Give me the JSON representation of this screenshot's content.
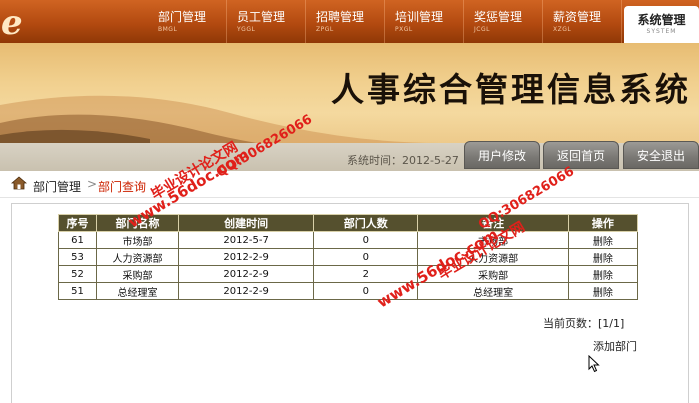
{
  "header": {
    "nav": [
      {
        "label": "部门管理",
        "sub": "BMGL"
      },
      {
        "label": "员工管理",
        "sub": "YGGL"
      },
      {
        "label": "招聘管理",
        "sub": "ZPGL"
      },
      {
        "label": "培训管理",
        "sub": "PXGL"
      },
      {
        "label": "奖惩管理",
        "sub": "JCGL"
      },
      {
        "label": "薪资管理",
        "sub": "XZGL"
      }
    ],
    "active": {
      "label": "系统管理",
      "sub": "SYSTEM"
    }
  },
  "banner": {
    "title": "人事综合管理信息系统",
    "system_time": "系统时间：2012-5-27",
    "buttons": {
      "profile": "用户修改",
      "home": "返回首页",
      "logout": "安全退出"
    }
  },
  "breadcrumb": {
    "parent": "部门管理",
    "sep": ">",
    "current": "部门查询"
  },
  "table": {
    "headers": [
      "序号",
      "部门名称",
      "创建时间",
      "部门人数",
      "备注",
      "操作"
    ],
    "rows": [
      [
        "61",
        "市场部",
        "2012-5-7",
        "0",
        "市场部",
        "删除"
      ],
      [
        "53",
        "人力资源部",
        "2012-2-9",
        "0",
        "人力资源部",
        "删除"
      ],
      [
        "52",
        "采购部",
        "2012-2-9",
        "2",
        "采购部",
        "删除"
      ],
      [
        "51",
        "总经理室",
        "2012-2-9",
        "0",
        "总经理室",
        "删除"
      ]
    ]
  },
  "pager": "当前页数：[1/1]",
  "add_link": "添加部门",
  "watermarks": {
    "site": "www.56doc.com",
    "brand": "毕业设计论文网",
    "qq": "QQ:306826066"
  },
  "colors": {
    "nav_bg": "#b34a10",
    "table_header": "#55502e",
    "crumb_active": "#cc2200",
    "watermark": "#e0201a"
  }
}
